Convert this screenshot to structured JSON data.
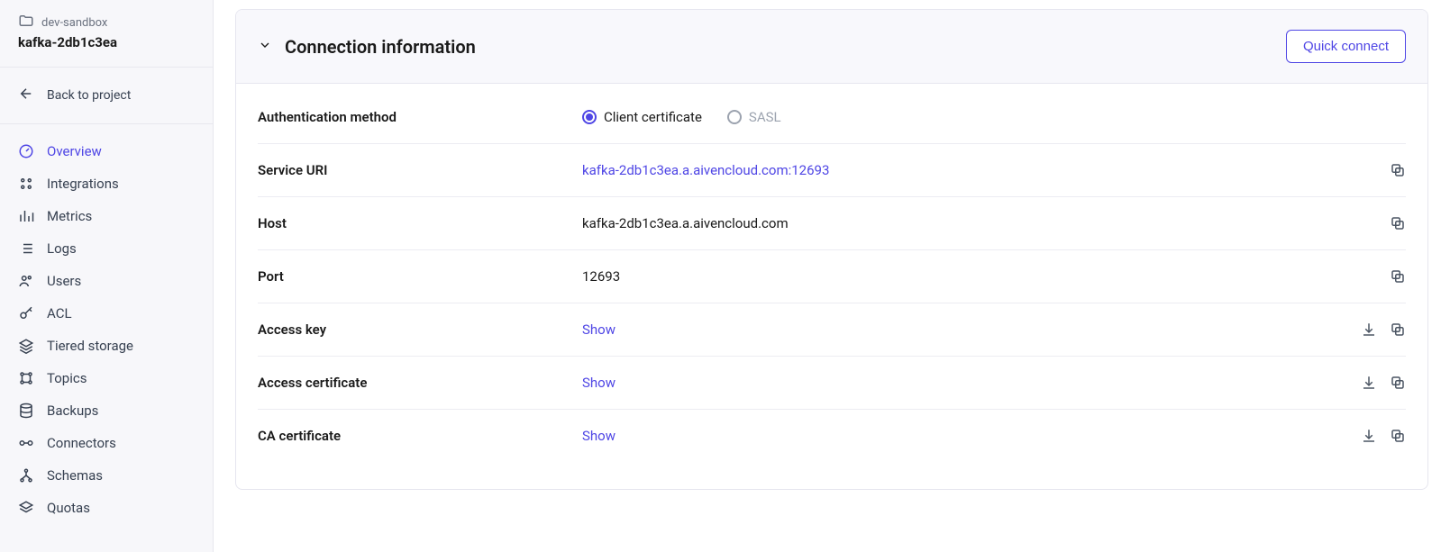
{
  "sidebar": {
    "project": "dev-sandbox",
    "service": "kafka-2db1c3ea",
    "back_label": "Back to project",
    "nav": [
      {
        "label": "Overview"
      },
      {
        "label": "Integrations"
      },
      {
        "label": "Metrics"
      },
      {
        "label": "Logs"
      },
      {
        "label": "Users"
      },
      {
        "label": "ACL"
      },
      {
        "label": "Tiered storage"
      },
      {
        "label": "Topics"
      },
      {
        "label": "Backups"
      },
      {
        "label": "Connectors"
      },
      {
        "label": "Schemas"
      },
      {
        "label": "Quotas"
      }
    ]
  },
  "panel": {
    "title": "Connection information",
    "quick_connect": "Quick connect",
    "auth": {
      "label": "Authentication method",
      "option_client_cert": "Client certificate",
      "option_sasl": "SASL"
    },
    "rows": {
      "service_uri_label": "Service URI",
      "service_uri_value": "kafka-2db1c3ea.a.aivencloud.com:12693",
      "host_label": "Host",
      "host_value": "kafka-2db1c3ea.a.aivencloud.com",
      "port_label": "Port",
      "port_value": "12693",
      "access_key_label": "Access key",
      "access_cert_label": "Access certificate",
      "ca_cert_label": "CA certificate",
      "show": "Show"
    }
  }
}
